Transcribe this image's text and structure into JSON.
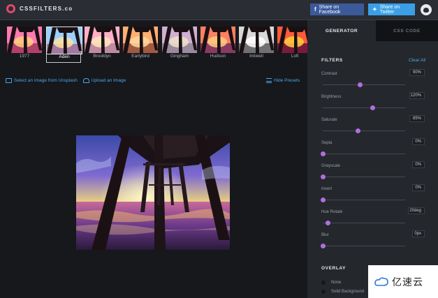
{
  "app": {
    "logo_text": "CSSFILTERS.co"
  },
  "share": {
    "facebook": "Share on Facebook",
    "twitter": "Share on Twitter"
  },
  "presets": [
    {
      "label": "1977",
      "active": false
    },
    {
      "label": "Aden",
      "active": true
    },
    {
      "label": "Brooklyn",
      "active": false
    },
    {
      "label": "Earlybird",
      "active": false
    },
    {
      "label": "Gingham",
      "active": false
    },
    {
      "label": "Hudson",
      "active": false
    },
    {
      "label": "Inkwell",
      "active": false
    },
    {
      "label": "Lofi",
      "active": false
    }
  ],
  "links": {
    "unsplash": "Select an Image from Unsplash",
    "upload": "Upload an Image",
    "hide_presets": "Hide Presets"
  },
  "panel": {
    "tabs": {
      "generator": "GENERATOR",
      "css_code": "CSS CODE"
    },
    "filters_title": "FILTERS",
    "clear_all": "Clear All",
    "filters": [
      {
        "label": "Contrast",
        "value": "90%",
        "level": 0.45
      },
      {
        "label": "Brightness",
        "value": "120%",
        "level": 0.6
      },
      {
        "label": "Saturate",
        "value": "85%",
        "level": 0.42
      },
      {
        "label": "Sepia",
        "value": "0%",
        "level": 0.0
      },
      {
        "label": "Grayscale",
        "value": "0%",
        "level": 0.0
      },
      {
        "label": "Invert",
        "value": "0%",
        "level": 0.0
      },
      {
        "label": "Hue Rotate",
        "value": "20deg",
        "level": 0.06
      },
      {
        "label": "Blur",
        "value": "0px",
        "level": 0.0
      }
    ],
    "overlay_title": "OVERLAY",
    "overlay_options": [
      "None",
      "Solid Background"
    ]
  },
  "watermark": {
    "text": "亿速云"
  },
  "colors": {
    "accent": "#4aa8e8",
    "knob": "#b06ee0",
    "facebook": "#3b5a9a",
    "twitter": "#3a9fe6"
  }
}
